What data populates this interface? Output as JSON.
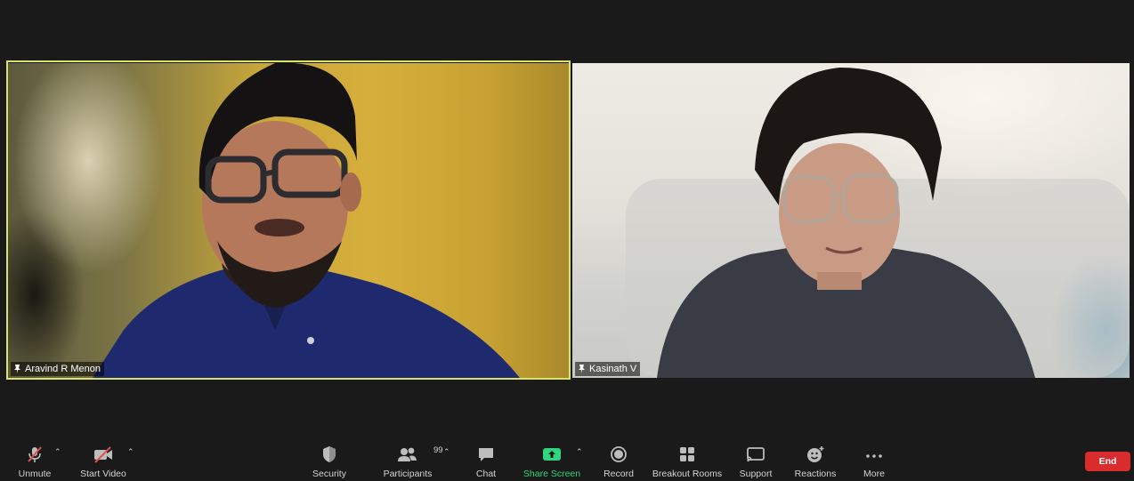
{
  "participants_tiles": [
    {
      "name": "Aravind R Menon"
    },
    {
      "name": "Kasinath V"
    }
  ],
  "toolbar": {
    "unmute_label": "Unmute",
    "start_video_label": "Start Video",
    "security_label": "Security",
    "participants_label": "Participants",
    "participants_count": "99",
    "chat_label": "Chat",
    "share_screen_label": "Share Screen",
    "record_label": "Record",
    "breakout_rooms_label": "Breakout Rooms",
    "support_label": "Support",
    "reactions_label": "Reactions",
    "more_label": "More",
    "end_label": "End"
  },
  "colors": {
    "active_speaker_border": "#d8e56a",
    "share_screen_green": "#2fd67e",
    "end_red": "#d92d2d",
    "background": "#1a1a1a"
  }
}
